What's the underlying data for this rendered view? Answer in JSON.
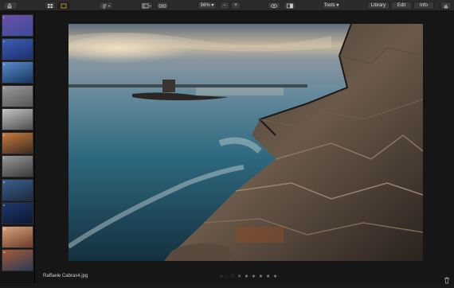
{
  "toolbar": {
    "zoom": "56%",
    "zoom_out": "−",
    "zoom_in": "+",
    "tools_label": "Tools",
    "library_label": "Library",
    "edit_label": "Edit",
    "info_label": "Info"
  },
  "sidebar": {
    "thumbnails": [
      {
        "num": "1",
        "colors": [
          "#6e4fa8",
          "#3b4d9a"
        ]
      },
      {
        "num": "2",
        "colors": [
          "#3b5fb5",
          "#1d2f70"
        ]
      },
      {
        "num": "3",
        "colors": [
          "#5a8ccf",
          "#16345c"
        ]
      },
      {
        "num": "4",
        "colors": [
          "#9a9a9a",
          "#555555"
        ]
      },
      {
        "num": "5",
        "colors": [
          "#c5c5c5",
          "#4d4d4d"
        ]
      },
      {
        "num": "6",
        "colors": [
          "#c87b3e",
          "#3d2a1e"
        ]
      },
      {
        "num": "7",
        "colors": [
          "#999999",
          "#3a3a3a"
        ]
      },
      {
        "num": "8",
        "colors": [
          "#3c5e8f",
          "#1b2a3f"
        ]
      },
      {
        "num": "9",
        "colors": [
          "#1e3a6e",
          "#0c1630"
        ]
      },
      {
        "num": "10",
        "colors": [
          "#d8a47a",
          "#6d3a2a"
        ]
      },
      {
        "num": "11",
        "colors": [
          "#a35a3a",
          "#2c3b52"
        ]
      }
    ]
  },
  "footer": {
    "filename": "Raffaele Cabras4.jpg",
    "rating": "○ · ♡   ✕ ★ ★ ★ ★ ★"
  }
}
